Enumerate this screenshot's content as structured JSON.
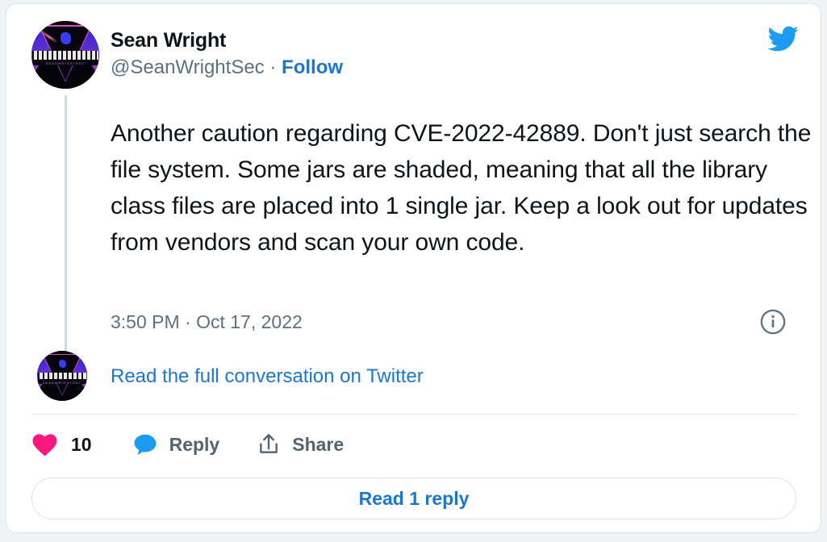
{
  "card": {
    "author": {
      "display_name": "Sean Wright",
      "handle": "@SeanWrightSec",
      "separator": "·",
      "follow_label": "Follow",
      "avatar_name": "sean-wright-avatar",
      "avatar_wordmark": "SEANWRIGHTSEC"
    },
    "brand_icon": "twitter-bird-icon",
    "tweet_text": "Another caution regarding CVE-2022-42889. Don't just search the file system. Some jars are shaded, meaning that all the library class files are placed into 1 single jar. Keep a look out for updates from vendors and scan your own code.",
    "meta": {
      "timestamp": "3:50 PM · Oct 17, 2022",
      "info_icon": "info-circle-icon"
    },
    "conversation_link": "Read the full conversation on Twitter",
    "actions": {
      "like": {
        "icon": "heart-icon",
        "count": "10"
      },
      "reply": {
        "icon": "speech-bubble-icon",
        "label": "Reply"
      },
      "share": {
        "icon": "share-upload-icon",
        "label": "Share"
      }
    },
    "read_replies_label": "Read 1 reply"
  },
  "colors": {
    "page_background": "#f0f3f5",
    "card_background": "#ffffff",
    "card_border": "#dfe3e6",
    "text_primary": "#0f1419",
    "text_secondary": "#5b7083",
    "link_blue": "#1b76d2",
    "brand_blue": "#1d9bf0",
    "like_pink": "#f91880",
    "thread_line": "#cfd9de"
  }
}
